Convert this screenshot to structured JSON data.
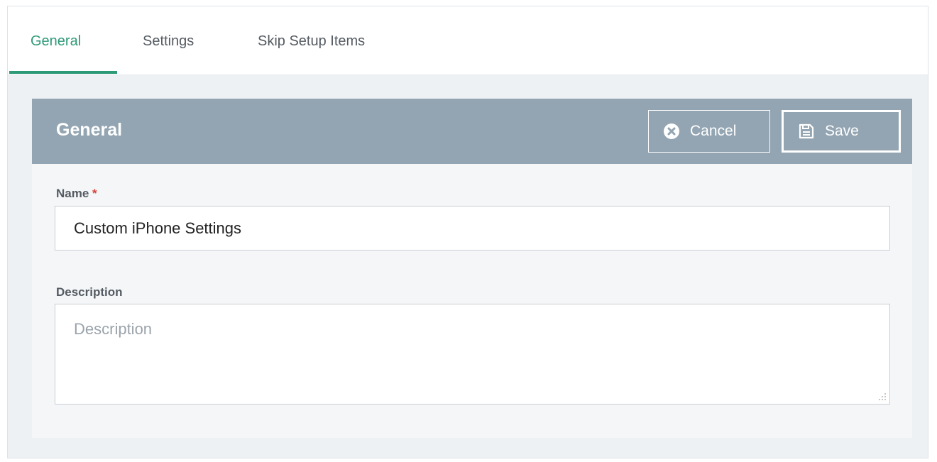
{
  "tabs": [
    {
      "label": "General",
      "active": true
    },
    {
      "label": "Settings",
      "active": false
    },
    {
      "label": "Skip Setup Items",
      "active": false
    }
  ],
  "panel": {
    "title": "General",
    "cancel_label": "Cancel",
    "save_label": "Save"
  },
  "form": {
    "name_label": "Name",
    "required_marker": "*",
    "name_value": "Custom iPhone Settings",
    "description_label": "Description",
    "description_value": "",
    "description_placeholder": "Description"
  },
  "colors": {
    "accent": "#2e9a78",
    "header_bg": "#93a5b2",
    "required": "#d9433b"
  },
  "icons": {
    "cancel": "close-circle-icon",
    "save": "floppy-disk-icon"
  }
}
